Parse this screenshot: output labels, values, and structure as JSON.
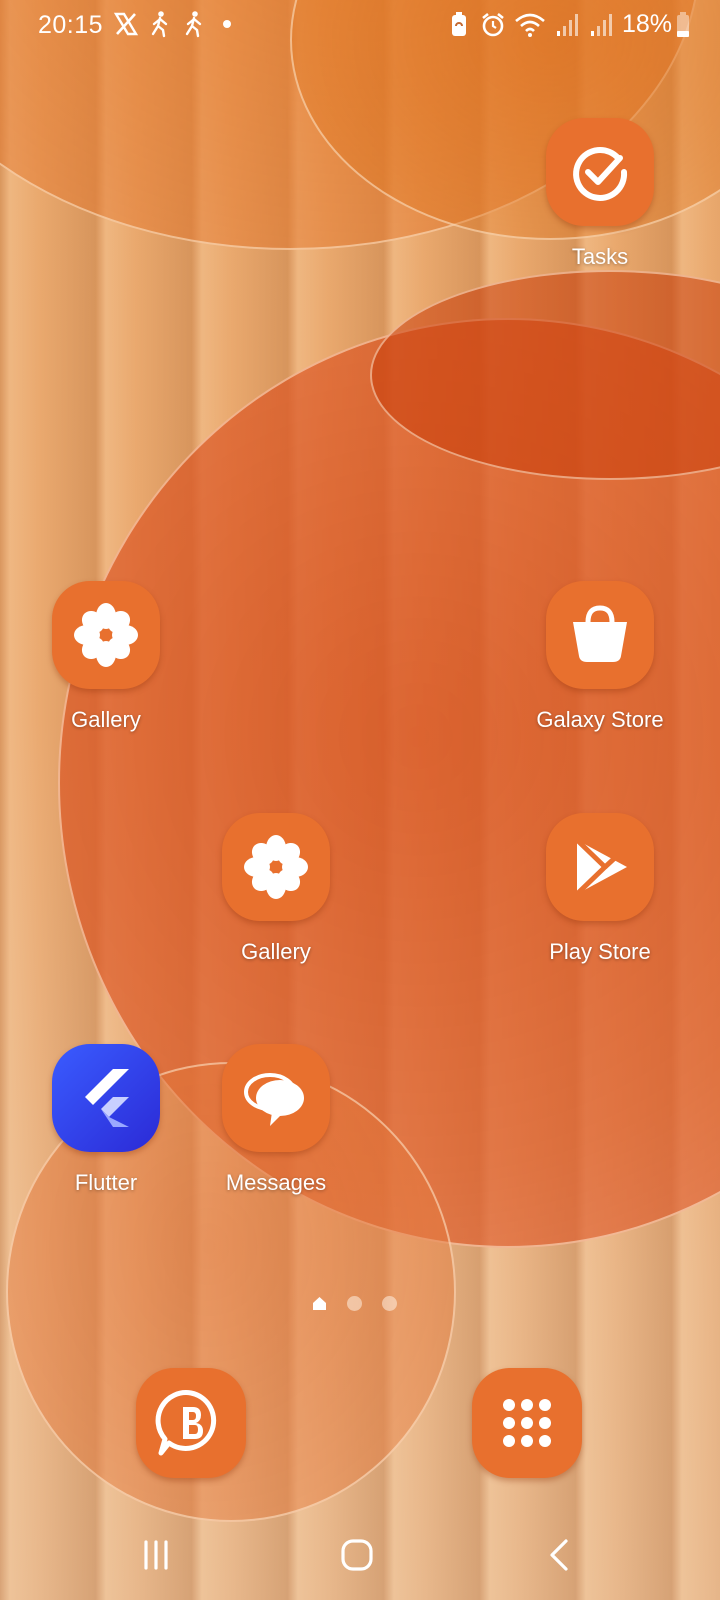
{
  "status_bar": {
    "time": "20:15",
    "left_icons": [
      "x-icon",
      "walking-icon",
      "walking-icon",
      "notification-dot"
    ],
    "right_icons": [
      "battery-saver-icon",
      "alarm-icon",
      "wifi-icon",
      "signal-icon",
      "signal-icon"
    ],
    "battery_percent": "18%"
  },
  "home_apps": [
    {
      "label": "Tasks",
      "icon": "tasks-check-icon"
    },
    {
      "label": "Gallery",
      "icon": "gallery-flower-icon"
    },
    {
      "label": "Galaxy Store",
      "icon": "shopping-bag-icon"
    },
    {
      "label": "Gallery",
      "icon": "gallery-flower-icon"
    },
    {
      "label": "Play Store",
      "icon": "play-store-icon"
    },
    {
      "label": "Flutter",
      "icon": "flutter-icon"
    },
    {
      "label": "Messages",
      "icon": "messages-icon"
    }
  ],
  "page_indicator": {
    "pages": 3,
    "current": 0,
    "first_is_home": true
  },
  "dock": [
    {
      "icon": "whatsapp-business-icon"
    },
    {
      "icon": "app-drawer-icon"
    }
  ],
  "nav_bar": [
    "recents-button",
    "home-button",
    "back-button"
  ],
  "colors": {
    "icon_tile": "#e8702e",
    "flutter_tile": "#3347f0",
    "label_text": "#ffffff"
  }
}
